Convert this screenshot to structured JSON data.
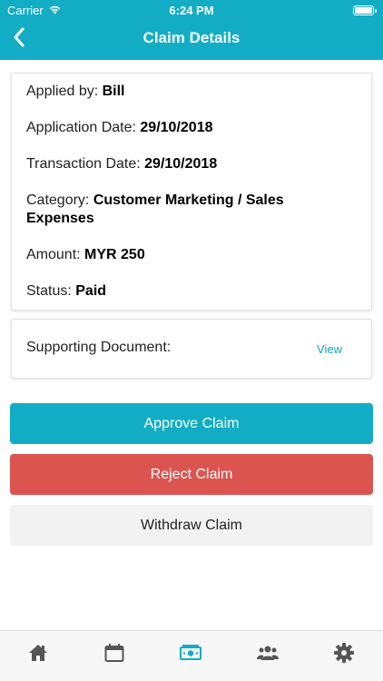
{
  "status_bar": {
    "carrier": "Carrier",
    "time": "6:24 PM"
  },
  "header": {
    "title": "Claim Details",
    "back_icon": "chevron-left-icon",
    "color": "#12adc4"
  },
  "details": {
    "applied_by_label": "Applied by: ",
    "applied_by": "Bill",
    "application_date_label": "Application Date: ",
    "application_date": "29/10/2018",
    "transaction_date_label": "Transaction Date: ",
    "transaction_date": "29/10/2018",
    "category_label": "Category: ",
    "category": "Customer Marketing / Sales Expenses",
    "amount_label": "Amount: ",
    "amount": "MYR 250",
    "status_label": "Status: ",
    "status": "Paid"
  },
  "supporting_document": {
    "label": "Supporting Document:",
    "view_link": "View"
  },
  "buttons": {
    "approve": "Approve Claim",
    "reject": "Reject Claim",
    "withdraw": "Withdraw Claim"
  },
  "colors": {
    "accent": "#12adc4",
    "reject": "#dc5450",
    "tab_inactive": "#555555"
  },
  "tabbar": {
    "items": [
      {
        "icon": "home-icon",
        "active": false
      },
      {
        "icon": "calendar-icon",
        "active": false
      },
      {
        "icon": "money-icon",
        "active": true
      },
      {
        "icon": "group-icon",
        "active": false
      },
      {
        "icon": "gear-icon",
        "active": false
      }
    ]
  }
}
